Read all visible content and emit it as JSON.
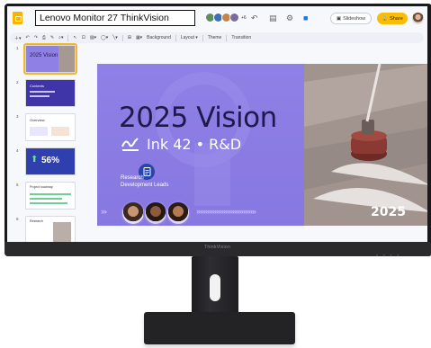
{
  "overlay": {
    "title": "Lenovo Monitor 27 ThinkVision"
  },
  "monitor": {
    "brand": "ThinkVision"
  },
  "header": {
    "slideshow_label": "Slideshow",
    "share_label": "Share",
    "collaborator_count": "+6"
  },
  "toolbar": {
    "items": [
      "Background",
      "Layout ▾",
      "Theme",
      "Transition"
    ]
  },
  "filmstrip": {
    "thumbnails": [
      {
        "number": "1",
        "title": "2025 Vision",
        "selected": true
      },
      {
        "number": "2",
        "title": "Contents",
        "selected": false
      },
      {
        "number": "3",
        "title": "Overview",
        "selected": false
      },
      {
        "number": "4",
        "title": "56%",
        "selected": false
      },
      {
        "number": "5",
        "title": "Project roadmap",
        "selected": false
      },
      {
        "number": "6",
        "title": "Research",
        "selected": false
      }
    ]
  },
  "slide": {
    "title": "2025 Vision",
    "subtitle": "Ink 42 • R&D",
    "research_line1": "Research",
    "research_line2": "Development Leads",
    "year": "2025"
  },
  "colors": {
    "slide_purple": "#8f80e6",
    "title_navy": "#1f1a4d",
    "share_yellow": "#fbbc04",
    "selection": "#f0b72f"
  }
}
